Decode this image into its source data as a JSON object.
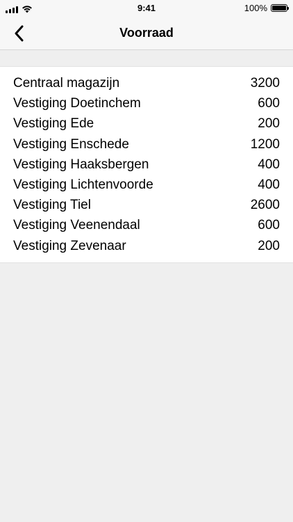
{
  "status_bar": {
    "time": "9:41",
    "battery_percent": "100%",
    "battery_level": 1.0,
    "icons": [
      "signal-icon",
      "wifi-icon",
      "battery-icon"
    ]
  },
  "nav": {
    "title": "Voorraad",
    "back_icon": "chevron-left-icon"
  },
  "stock": {
    "rows": [
      {
        "location": "Centraal magazijn",
        "quantity": "3200"
      },
      {
        "location": "Vestiging Doetinchem",
        "quantity": "600"
      },
      {
        "location": "Vestiging Ede",
        "quantity": "200"
      },
      {
        "location": "Vestiging Enschede",
        "quantity": "1200"
      },
      {
        "location": "Vestiging Haaksbergen",
        "quantity": "400"
      },
      {
        "location": "Vestiging Lichtenvoorde",
        "quantity": "400"
      },
      {
        "location": "Vestiging Tiel",
        "quantity": "2600"
      },
      {
        "location": "Vestiging Veenendaal",
        "quantity": "600"
      },
      {
        "location": "Vestiging Zevenaar",
        "quantity": "200"
      }
    ]
  },
  "colors": {
    "background": "#efefef",
    "bar_background": "#f7f7f7",
    "list_background": "#ffffff",
    "text": "#000000"
  }
}
